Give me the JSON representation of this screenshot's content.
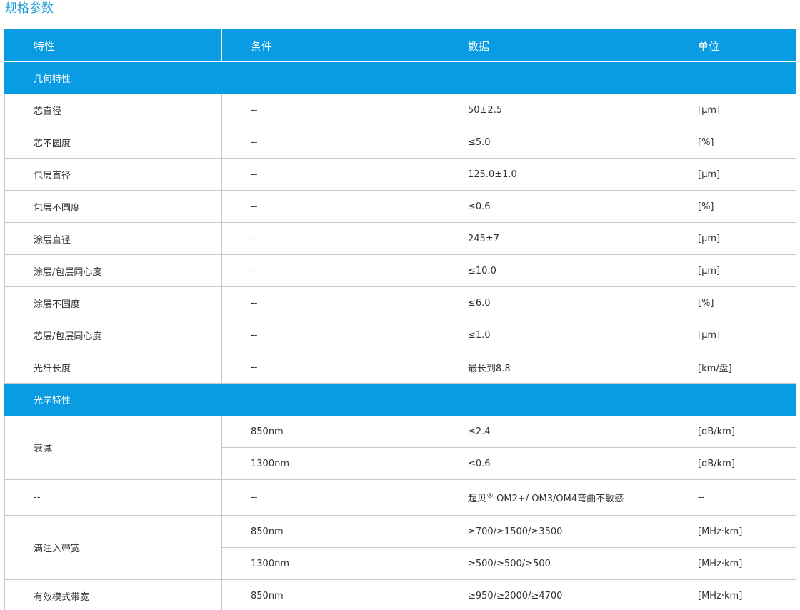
{
  "page": {
    "title": "规格参数"
  },
  "table": {
    "headers": [
      "特性",
      "条件",
      "数据",
      "单位"
    ],
    "geometry_section": "几何特性",
    "geometry_rows": [
      {
        "property": "芯直径",
        "condition": "--",
        "value": "50±2.5",
        "unit": "[μm]"
      },
      {
        "property": "芯不圆度",
        "condition": "--",
        "value": "≤5.0",
        "unit": "[%]"
      },
      {
        "property": "包层直径",
        "condition": "--",
        "value": "125.0±1.0",
        "unit": "[μm]"
      },
      {
        "property": "包层不圆度",
        "condition": "--",
        "value": "≤0.6",
        "unit": "[%]"
      },
      {
        "property": "涂层直径",
        "condition": "--",
        "value": "245±7",
        "unit": "[μm]"
      },
      {
        "property": "涂层/包层同心度",
        "condition": "--",
        "value": "≤10.0",
        "unit": "[μm]"
      },
      {
        "property": "涂层不圆度",
        "condition": "--",
        "value": "≤6.0",
        "unit": "[%]"
      },
      {
        "property": "芯层/包层同心度",
        "condition": "--",
        "value": "≤1.0",
        "unit": "[μm]"
      },
      {
        "property": "光纤长度",
        "condition": "--",
        "value": "最长到8.8",
        "unit": "[km/盘]"
      }
    ],
    "optical_section": "光学特性",
    "attenuation": {
      "property": "衰减",
      "rows": [
        {
          "condition": "850nm",
          "value": "≤2.4",
          "unit": "[dB/km]"
        },
        {
          "condition": "1300nm",
          "value": "≤0.6",
          "unit": "[dB/km]"
        }
      ]
    },
    "bend_row": {
      "property": "--",
      "condition": "--",
      "value_prefix": "超贝",
      "value_mark": "®",
      "value_suffix": " OM2+/ OM3/OM4弯曲不敏感",
      "unit": "--"
    },
    "overfilled": {
      "property": "满注入带宽",
      "rows": [
        {
          "condition": "850nm",
          "value": "≥700/≥1500/≥3500",
          "unit": "[MHz·km]"
        },
        {
          "condition": "1300nm",
          "value": "≥500/≥500/≥500",
          "unit": "[MHz·km]"
        }
      ]
    },
    "effective_modal": {
      "property": "有效模式带宽",
      "condition": "850nm",
      "value": "≥950/≥2000/≥4700",
      "unit": "[MHz·km]"
    }
  }
}
